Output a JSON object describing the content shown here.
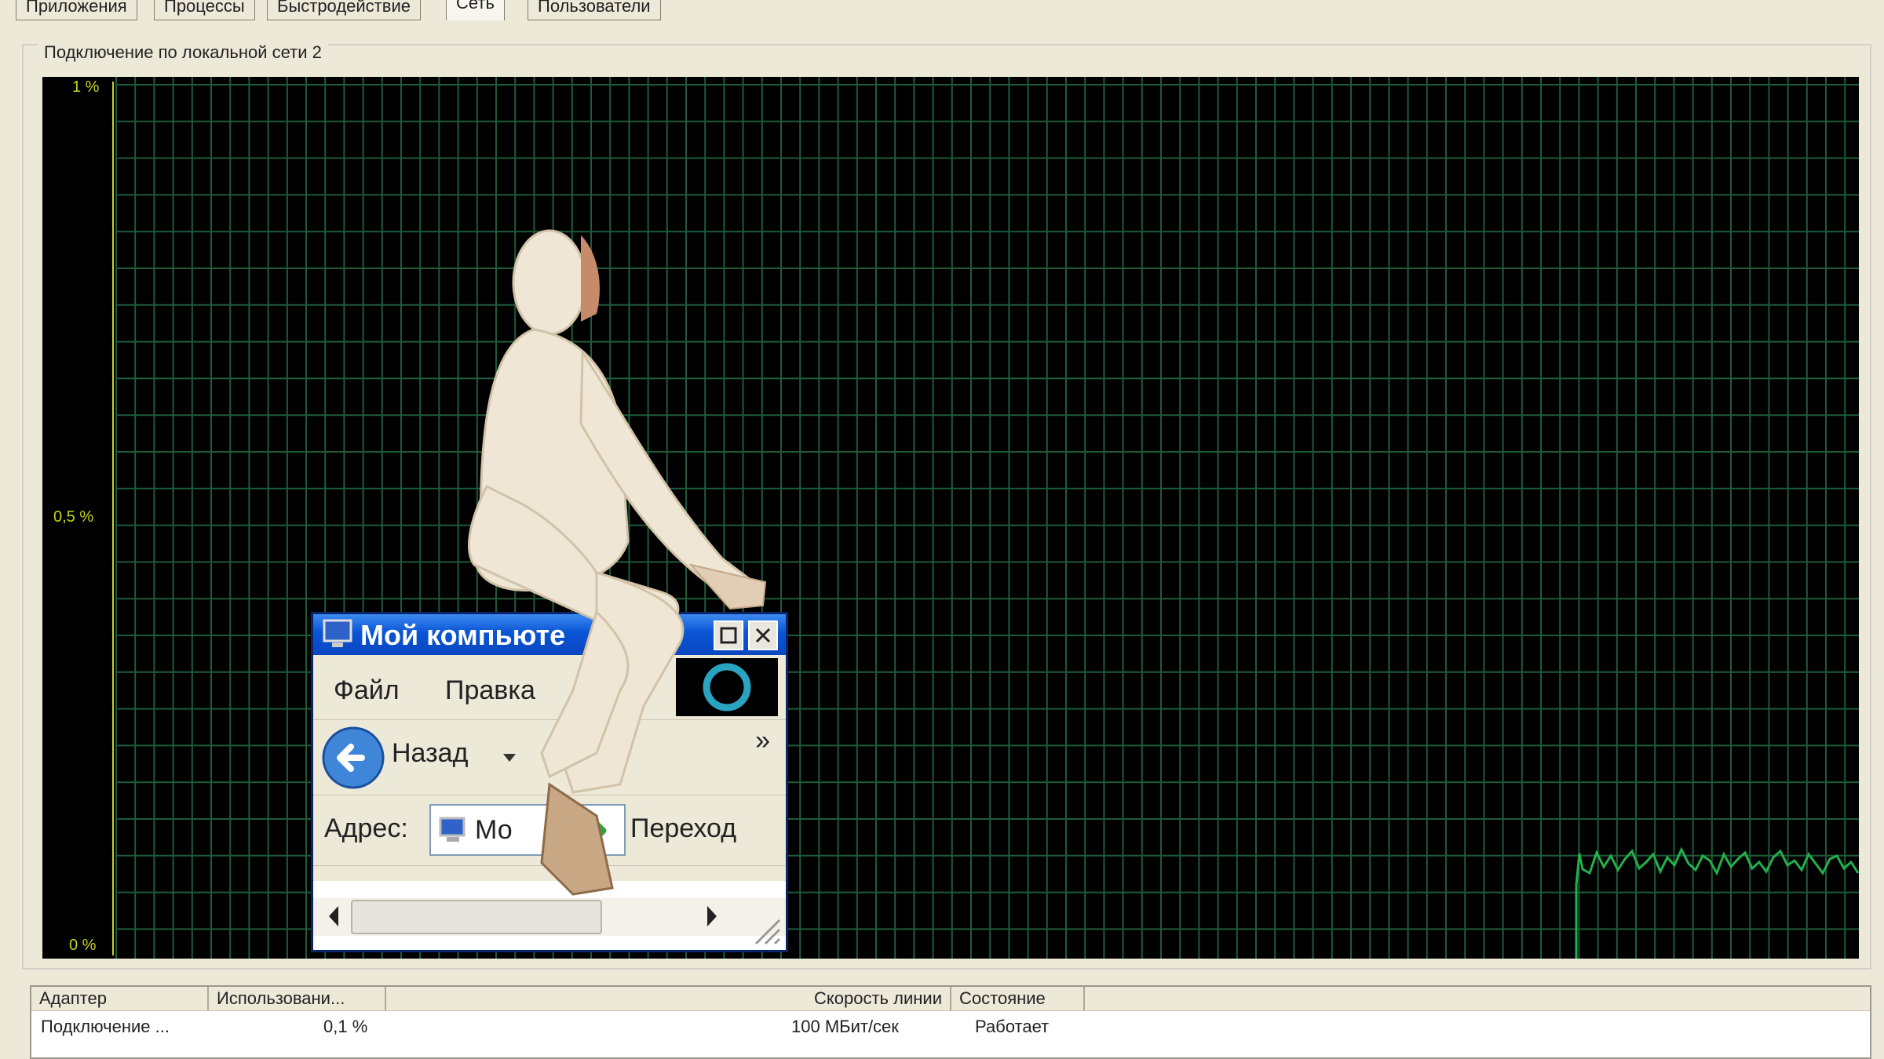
{
  "tabs": [
    "Приложения",
    "Процессы",
    "Быстродействие",
    "Сеть",
    "Пользователи"
  ],
  "group_title": "Подключение по локальной сети 2",
  "graph": {
    "y_ticks": [
      "1 %",
      "0,5 %",
      "0 %"
    ],
    "grid_color": "#1f5a3a",
    "line_color": "#22b14c",
    "axis_color": "#c8d41a"
  },
  "table": {
    "columns": [
      "Адаптер",
      "Использовани...",
      "Скорость линии",
      "Состояние"
    ],
    "rows": [
      [
        "Подключение ...",
        "0,1 %",
        "100 МБит/сек",
        "Работает"
      ]
    ]
  },
  "explorer_window": {
    "title": "Мой компьюте",
    "menu": [
      "Файл",
      "Правка"
    ],
    "back_label": "Назад",
    "chevron": "»",
    "address_label": "Адрес:",
    "address_value": "Мо",
    "go_label": "Переход"
  }
}
